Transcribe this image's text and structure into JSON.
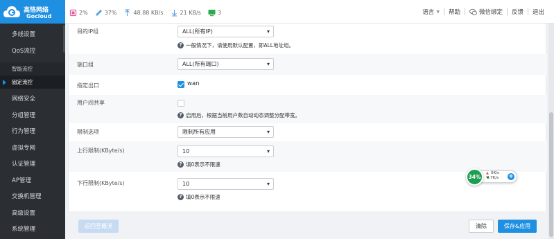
{
  "brand": {
    "name": "高恪网络",
    "sub": "Gocloud"
  },
  "stats": {
    "cpu": "2%",
    "mem": "37%",
    "up_speed": "48.88 KB/s",
    "down_speed": "21 KB/s",
    "screen_count": "3"
  },
  "top_links": {
    "language": "语言",
    "help": "帮助",
    "wechat": "微信绑定",
    "feedback": "反馈",
    "logout": "退出"
  },
  "sidebar": {
    "items": [
      {
        "label": "多线设置"
      },
      {
        "label": "QoS流控"
      },
      {
        "label": "智能流控"
      },
      {
        "label": "固定流控"
      },
      {
        "label": "网络安全"
      },
      {
        "label": "分组管理"
      },
      {
        "label": "行为管理"
      },
      {
        "label": "虚拟专网"
      },
      {
        "label": "认证管理"
      },
      {
        "label": "AP管理"
      },
      {
        "label": "交换机管理"
      },
      {
        "label": "高级设置"
      },
      {
        "label": "系统管理"
      }
    ]
  },
  "form": {
    "dst_ip_group": {
      "label": "目的IP组",
      "value": "ALL(所有IP)",
      "hint": "一般情况下，请使用默认配置，即ALL地址组。"
    },
    "port_group": {
      "label": "端口组",
      "value": "ALL(所有端口)"
    },
    "out_interface": {
      "label": "指定出口",
      "option": "wan",
      "checked": true
    },
    "user_share": {
      "label": "用户间共享",
      "checked": false,
      "hint": "启用后，根据当前用户数自动动态调整分配带宽。"
    },
    "limit_option": {
      "label": "限制选项",
      "value": "限制所有应用"
    },
    "up_limit": {
      "label": "上行限制(KByte/s)",
      "value": "10",
      "hint": "填0表示不限速"
    },
    "down_limit": {
      "label": "下行限制(KByte/s)",
      "value": "10",
      "hint": "填0表示不限速"
    }
  },
  "buttons": {
    "back": "返回至概况",
    "clear": "清除",
    "save": "保存&应用"
  },
  "widget": {
    "percent": "34%",
    "up": "0K/s",
    "down": "4.7K/s"
  },
  "colors": {
    "brand_blue": "#1e8fe1",
    "sidebar_bg": "#2b2e33",
    "widget_green": "#1e9e52"
  }
}
